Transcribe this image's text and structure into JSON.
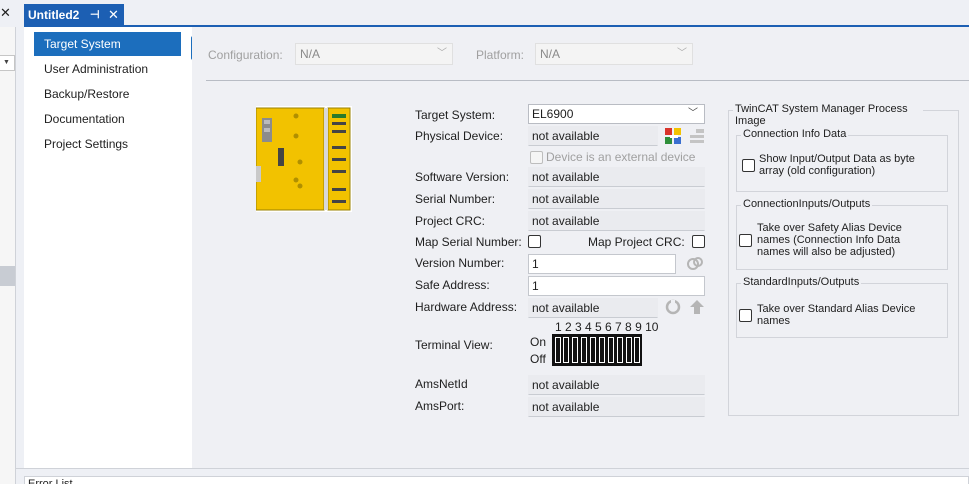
{
  "tab": {
    "title": "Untitled2",
    "pin_glyph": "⊣",
    "close_glyph": "✕"
  },
  "left_close_glyph": "✕",
  "nav": {
    "items": [
      {
        "label": "Target System"
      },
      {
        "label": "User Administration"
      },
      {
        "label": "Backup/Restore"
      },
      {
        "label": "Documentation"
      },
      {
        "label": "Project Settings"
      }
    ]
  },
  "toolbar": {
    "configuration_label": "Configuration:",
    "configuration_value": "N/A",
    "platform_label": "Platform:",
    "platform_value": "N/A"
  },
  "form": {
    "target_system_label": "Target System:",
    "target_system_value": "EL6900",
    "physical_device_label": "Physical Device:",
    "physical_device_value": "not available",
    "external_device_label": "Device is an external device",
    "software_version_label": "Software Version:",
    "software_version_value": "not available",
    "serial_number_label": "Serial Number:",
    "serial_number_value": "not available",
    "project_crc_label": "Project CRC:",
    "project_crc_value": "not available",
    "map_serial_label": "Map Serial Number:",
    "map_project_crc_label": "Map Project CRC:",
    "version_number_label": "Version Number:",
    "version_number_value": "1",
    "safe_address_label": "Safe Address:",
    "safe_address_value": "1",
    "hardware_address_label": "Hardware Address:",
    "hardware_address_value": "not available",
    "terminal_view_label": "Terminal View:",
    "on_label": "On",
    "off_label": "Off",
    "dip_numbers": "1 2 3 4 5 6 7 8 9 10",
    "ams_netid_label": "AmsNetId",
    "ams_netid_value": "not available",
    "ams_port_label": "AmsPort:",
    "ams_port_value": "not available"
  },
  "process_image": {
    "title_line1": "TwinCAT System Manager Process",
    "title_line2": "Image",
    "connection_info": {
      "title": "Connection Info Data",
      "checkbox_line1": "Show Input/Output Data as byte",
      "checkbox_line2": "array (old configuration)"
    },
    "connection_io": {
      "title": "ConnectionInputs/Outputs",
      "checkbox_line1": "Take over Safety Alias Device",
      "checkbox_line2": "names (Connection Info Data",
      "checkbox_line3": "names will also be adjusted)"
    },
    "standard_io": {
      "title": "StandardInputs/Outputs",
      "checkbox_line1": "Take over Standard Alias Device",
      "checkbox_line2": "names"
    }
  },
  "bottom_panel_label": "Error List",
  "colors": {
    "accent": "#1c6ebd",
    "tab": "#1c5fb3",
    "terminal_yellow": "#f2c200"
  }
}
